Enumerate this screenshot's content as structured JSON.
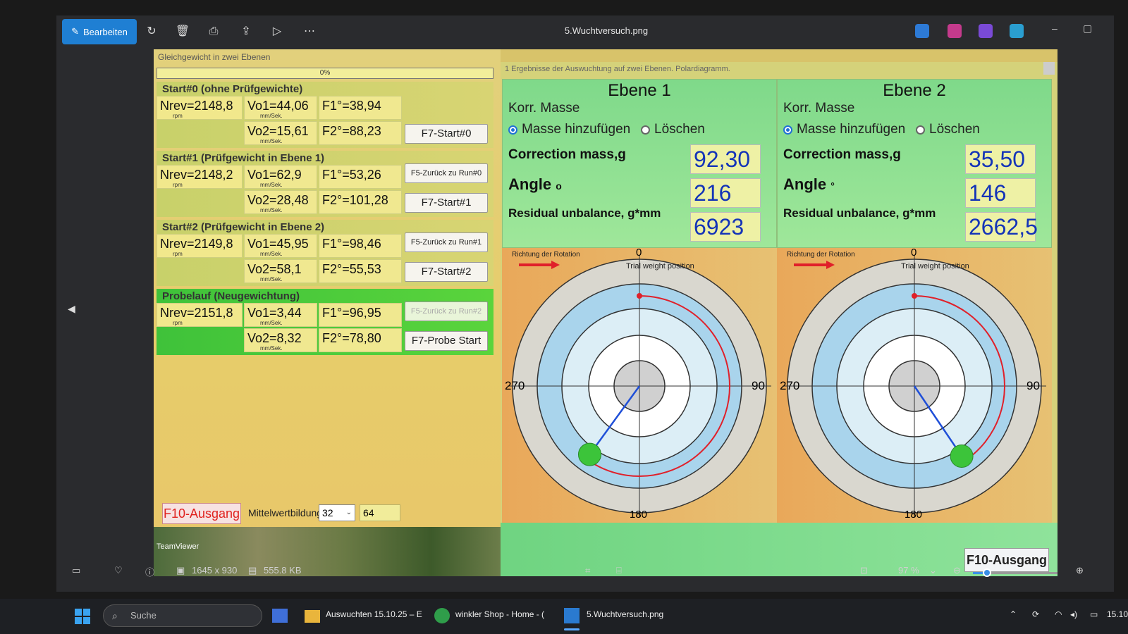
{
  "toolbar": {
    "edit_label": "Bearbeiten",
    "file_name": "5.Wuchtversuch.png",
    "icons": [
      "edit-icon",
      "rotate-icon",
      "delete-icon",
      "print-icon",
      "share-icon",
      "slideshow-icon",
      "more-icon"
    ]
  },
  "left": {
    "title": "Gleichgewicht in zwei Ebenen",
    "progress": "0%",
    "runs": [
      {
        "title": "Start#0 (ohne Prüfgewichte)",
        "nrev": "Nrev=2148,8",
        "vo1": "Vo1=44,06",
        "f1": "F1°=38,94",
        "vo2": "Vo2=15,61",
        "f2": "F2°=88,23",
        "btn_top": "",
        "btn_bottom": "F7-Start#0"
      },
      {
        "title": "Start#1 (Prüfgewicht in Ebene 1)",
        "nrev": "Nrev=2148,2",
        "vo1": "Vo1=62,9",
        "f1": "F1°=53,26",
        "vo2": "Vo2=28,48",
        "f2": "F2°=101,28",
        "btn_top": "F5-Zurück zu Run#0",
        "btn_bottom": "F7-Start#1"
      },
      {
        "title": "Start#2 (Prüfgewicht in Ebene 2)",
        "nrev": "Nrev=2149,8",
        "vo1": "Vo1=45,95",
        "f1": "F1°=98,46",
        "vo2": "Vo2=58,1",
        "f2": "F2°=55,53",
        "btn_top": "F5-Zurück zu Run#1",
        "btn_bottom": "F7-Start#2"
      },
      {
        "title": "Probelauf (Neugewichtung)",
        "nrev": "Nrev=2151,8",
        "vo1": "Vo1=3,44",
        "f1": "F1°=96,95",
        "vo2": "Vo2=8,32",
        "f2": "F2°=78,80",
        "btn_top": "F5-Zurück zu Run#2",
        "btn_bottom": "F7-Probe Start"
      }
    ],
    "unit_rpm": "rpm",
    "unit_speed": "mm/Sek.",
    "exit": "F10-Ausgang",
    "avg_label": "Mittelwertbildung",
    "avg_select": "32",
    "avg_value": "64",
    "teamviewer": "TeamViewer"
  },
  "right": {
    "title": "1 Ergebnisse der Auswuchtung auf zwei Ebenen. Polardiagramm.",
    "planes": [
      {
        "name": "Ebene 1",
        "korr": "Korr. Masse",
        "radio_add": "Masse hinzufügen",
        "radio_del": "Löschen",
        "mass_label": "Correction mass,g",
        "mass": "92,30",
        "angle_label": "Angle",
        "angle_unit": "o",
        "angle": "216",
        "residual_label": "Residual unbalance, g*mm",
        "residual": "6923",
        "rotation": "Richtung der Rotation",
        "trial": "Trial weight position",
        "angle_deg": 216
      },
      {
        "name": "Ebene 2",
        "korr": "Korr. Masse",
        "radio_add": "Masse hinzufügen",
        "radio_del": "Löschen",
        "mass_label": "Correction mass,g",
        "mass": "35,50",
        "angle_label": "Angle",
        "angle_unit": "°",
        "angle": "146",
        "residual_label": "Residual unbalance, g*mm",
        "residual": "2662,5",
        "rotation": "Richtung der Rotation",
        "trial": "Trial weight position",
        "angle_deg": 146
      }
    ],
    "axis": {
      "top": "0",
      "right": "90",
      "bottom": "180",
      "left": "270"
    },
    "exit": "F10-Ausgang"
  },
  "status": {
    "dimensions": "1645 x 930",
    "size": "555.8 KB",
    "zoom": "97 %",
    "zoom_level": 0.1
  },
  "taskbar": {
    "search": "Suche",
    "item1": "Auswuchten 15.10.25 – E",
    "item2": "winkler Shop - Home - (",
    "item3": "5.Wuchtversuch.png",
    "clock": "15.10"
  },
  "colors": {
    "accent": "#1f7fd3",
    "value_blue": "#1434b8",
    "exit_red": "#e0221e",
    "trial_red": "#e0202a",
    "vector_blue": "#1f4fd8",
    "mass_green": "#3cc43a"
  }
}
